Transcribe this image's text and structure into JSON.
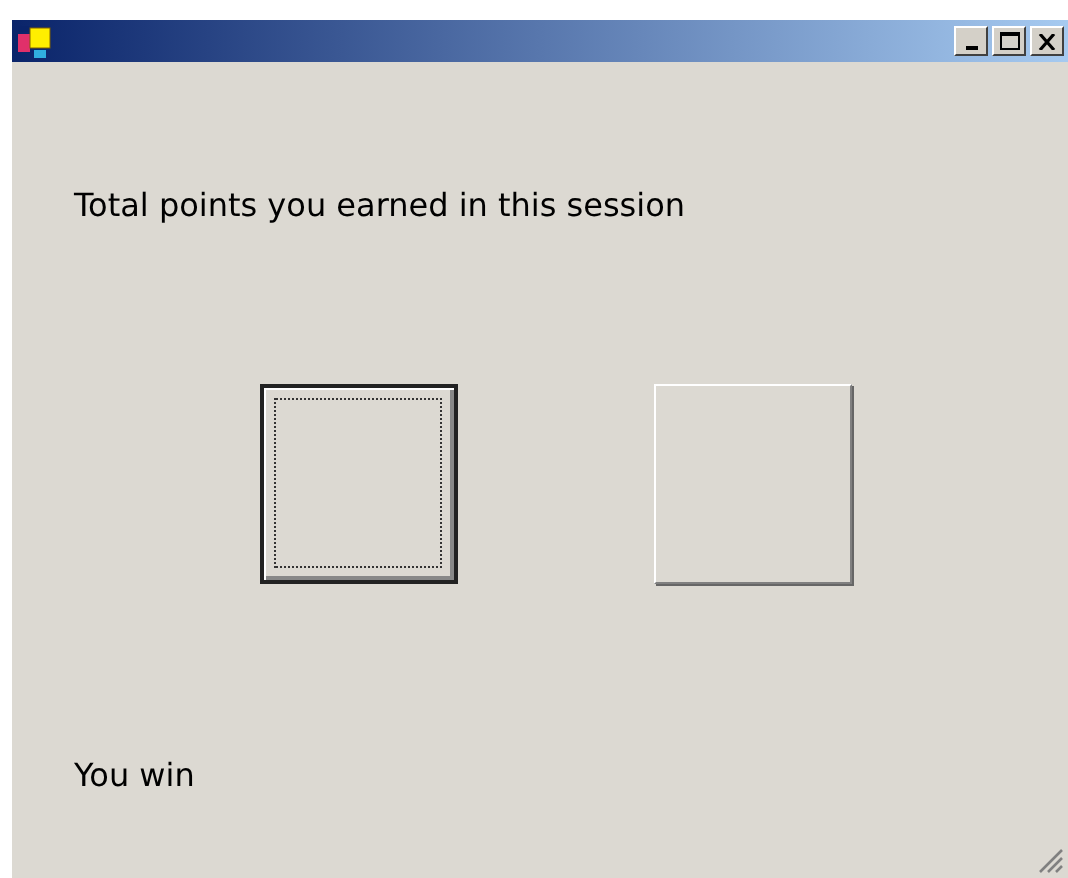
{
  "window": {
    "active": true
  },
  "label": "Total points you earned in this session",
  "buttons": [
    {
      "focused": true
    },
    {
      "focused": false
    }
  ],
  "status": "You win"
}
